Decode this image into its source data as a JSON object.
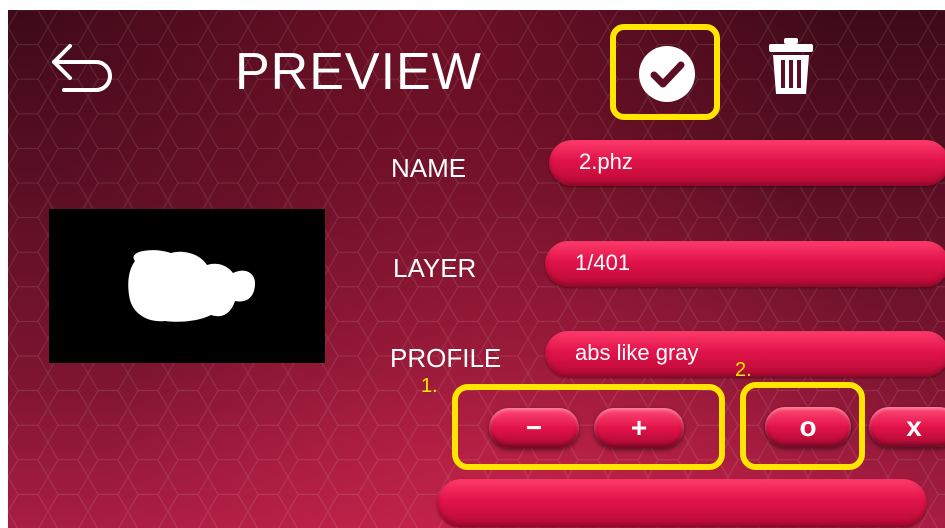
{
  "header": {
    "title": "PREVIEW",
    "back_icon": "back-arrow-icon",
    "confirm_icon": "check-circle-icon",
    "delete_icon": "trash-icon"
  },
  "fields": {
    "name": {
      "label": "NAME",
      "value": "2.phz"
    },
    "layer": {
      "label": "LAYER",
      "value": "1/401"
    },
    "profile": {
      "label": "PROFILE",
      "value": "abs like gray"
    }
  },
  "controls": {
    "minus_label": "−",
    "plus_label": "+",
    "ok_label": "o",
    "cancel_label": "x",
    "status_text": ""
  },
  "annotations": {
    "step1": "1.",
    "step2": "2."
  },
  "colors": {
    "highlight": "#ffe600",
    "accent": "#e0134a",
    "background_dark": "#3e0a18"
  }
}
